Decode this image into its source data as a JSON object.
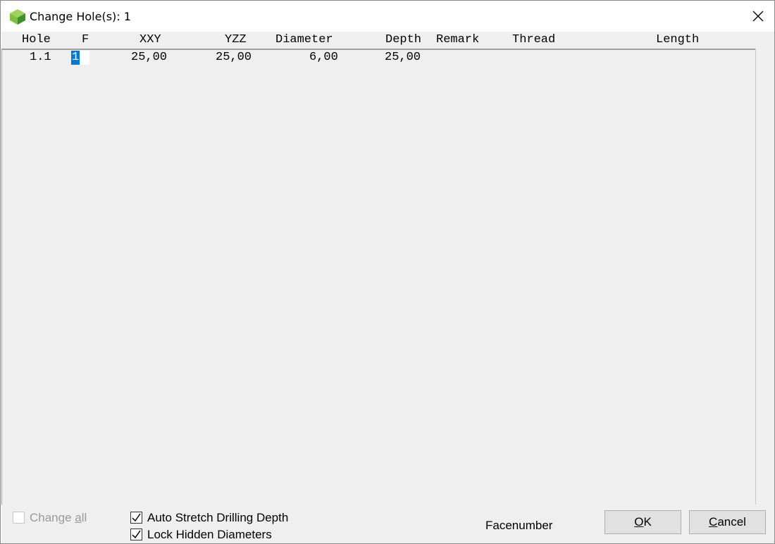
{
  "window": {
    "title": "Change Hole(s): 1",
    "icon": "green-cube-icon",
    "close_icon": "close-icon"
  },
  "grid": {
    "columns": [
      "Hole",
      "F",
      "XXY",
      "YZZ",
      "Diameter",
      "Depth",
      "Remark",
      "Thread",
      "Length"
    ],
    "rows": [
      {
        "hole": "1.1",
        "f": "1",
        "xxy": "25,00",
        "yzz": "25,00",
        "diameter": "6,00",
        "depth": "25,00",
        "remark": "",
        "thread": "",
        "length": ""
      }
    ]
  },
  "footer": {
    "change_all": {
      "pre": "Change ",
      "accel": "a",
      "post": "ll",
      "checked": false,
      "enabled": false
    },
    "auto_stretch": {
      "label": "Auto Stretch Drilling Depth",
      "checked": true
    },
    "lock_hidden": {
      "label": "Lock Hidden Diameters",
      "checked": true
    },
    "status_text": "Facenumber",
    "ok": {
      "accel": "O",
      "post": "K"
    },
    "cancel": {
      "accel": "C",
      "post": "ancel"
    }
  },
  "colors": {
    "selection": "#0078d7",
    "grid_background": "#efefef",
    "icon_green_light": "#7dc242",
    "icon_green_dark": "#3f8f2a"
  }
}
